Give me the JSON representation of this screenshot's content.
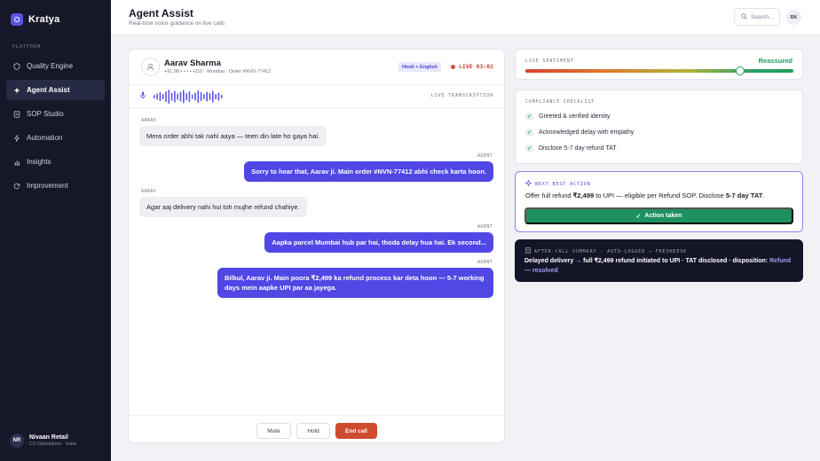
{
  "app": {
    "name": "Kratya"
  },
  "sidebar": {
    "section_label": "PLATFORM",
    "items": [
      {
        "label": "Quality Engine",
        "icon": "shield-icon",
        "active": false
      },
      {
        "label": "Agent Assist",
        "icon": "sparkle-icon",
        "active": true
      },
      {
        "label": "SOP Studio",
        "icon": "document-icon",
        "active": false
      },
      {
        "label": "Automation",
        "icon": "bolt-icon",
        "active": false
      },
      {
        "label": "Insights",
        "icon": "bar-chart-icon",
        "active": false
      },
      {
        "label": "Improvement",
        "icon": "refresh-icon",
        "active": false
      }
    ],
    "org": {
      "initials": "NR",
      "name": "Nivaan Retail",
      "sub": "CX Operations · India"
    }
  },
  "header": {
    "title": "Agent Assist",
    "subtitle": "Real-time voice guidance on live calls",
    "search_placeholder": "Search...",
    "user_initials": "RK"
  },
  "call": {
    "caller_name": "Aarav Sharma",
    "caller_meta": "+91 98 • • • • •210 · Mumbai · Order #NVN-77412",
    "language": "Hindi + English",
    "live_label": "LIVE 03:02",
    "transcription_label": "LIVE TRANSCRIPTION",
    "messages": [
      {
        "speaker": "AARAV",
        "text": "Mera order abhi tak nahi aaya — teen din late ho gaya hai."
      },
      {
        "speaker": "AGENT",
        "text": "Sorry to hear that, Aarav ji. Main order #NVN-77412 abhi check karta hoon."
      },
      {
        "speaker": "AARAV",
        "text": "Agar aaj delivery nahi hui toh mujhe refund chahiye."
      },
      {
        "speaker": "AGENT",
        "text": "Aapka parcel Mumbai hub par hai, thoda delay hua hai. Ek second..."
      },
      {
        "speaker": "AGENT",
        "text_line1": "Bilkul, Aarav ji. Main poora ₹2,499 ka refund process kar deta hoon — ",
        "text_bold1": "5-7",
        "text_bold2": "working days",
        "text_line2": " mein aapke UPI par aa jayega."
      }
    ],
    "controls": {
      "mute": "Mute",
      "hold": "Hold",
      "end": "End call"
    }
  },
  "sentiment": {
    "label": "LIVE SENTIMENT",
    "value": "Reassured",
    "level": 0.8
  },
  "compliance": {
    "label": "COMPLIANCE CHECKLIST",
    "items": [
      "Greeted & verified identity",
      "Acknowledged delay with empathy",
      "Disclose 5-7 day refund TAT"
    ]
  },
  "next_best_action": {
    "label": "NEXT BEST ACTION",
    "text_a": "Offer full refund ",
    "amount": "₹2,499",
    "text_b": " to UPI — eligible per Refund SOP. Disclose ",
    "tat": "5-7 day TAT",
    "text_c": ".",
    "button": "Action taken"
  },
  "summary": {
    "label": "AFTER-CALL SUMMARY · AUTO-LOGGED → FRESHDESK",
    "text": "Delayed delivery → full ₹2,499 refund initiated to UPI · TAT disclosed · disposition: ",
    "disposition": "Refund — resolved"
  },
  "colors": {
    "accent": "#5047e5",
    "success": "#1f9160",
    "danger": "#cf4a2f",
    "sidebar": "#161829"
  }
}
